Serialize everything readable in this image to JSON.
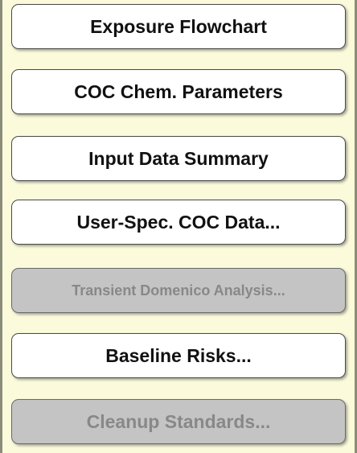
{
  "buttons": [
    {
      "label": "Exposure Flowchart",
      "enabled": true
    },
    {
      "label": "COC Chem. Parameters",
      "enabled": true
    },
    {
      "label": "Input Data Summary",
      "enabled": true
    },
    {
      "label": "User-Spec. COC Data...",
      "enabled": true
    },
    {
      "label": "Transient Domenico Analysis...",
      "enabled": false
    },
    {
      "label": "Baseline Risks...",
      "enabled": true
    },
    {
      "label": "Cleanup Standards...",
      "enabled": false
    }
  ],
  "colors": {
    "background": "#fbfbdc",
    "button_enabled": "#ffffff",
    "button_disabled": "#c4c4c4",
    "text_enabled": "#111111",
    "text_disabled": "#888888"
  }
}
